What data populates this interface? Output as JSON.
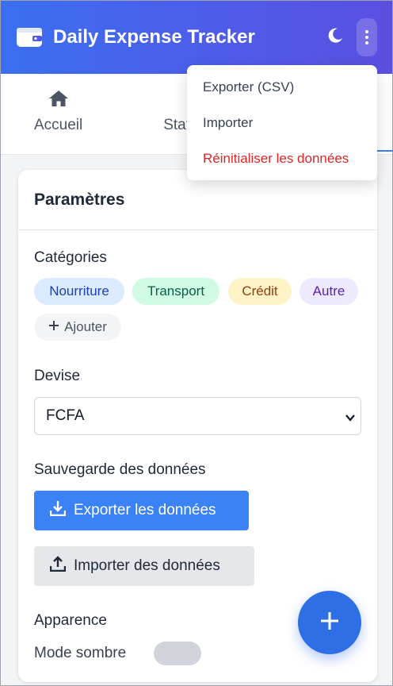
{
  "header": {
    "title": "Daily Expense Tracker"
  },
  "tabs": [
    {
      "label": "Accueil",
      "icon": "home-icon"
    },
    {
      "label": "Statis",
      "icon": "chart-pie-icon"
    }
  ],
  "menu": {
    "items": [
      {
        "label": "Exporter (CSV)"
      },
      {
        "label": "Importer"
      },
      {
        "label": "Réinitialiser les données",
        "color": "#dc2626"
      }
    ]
  },
  "settings": {
    "title": "Paramètres",
    "categories_label": "Catégories",
    "categories": [
      {
        "label": "Nourriture",
        "bg": "#dbeafe",
        "fg": "#1e40af"
      },
      {
        "label": "Transport",
        "bg": "#d1fae5",
        "fg": "#065f46"
      },
      {
        "label": "Crédit",
        "bg": "#fef3c7",
        "fg": "#92400e"
      },
      {
        "label": "Autre",
        "bg": "#ede9fe",
        "fg": "#5b21b6"
      }
    ],
    "add_category_label": "Ajouter",
    "currency_label": "Devise",
    "currency_value": "FCFA",
    "backup_label": "Sauvegarde des données",
    "export_button": "Exporter les données",
    "import_button": "Importer des données",
    "appearance_label": "Apparence",
    "dark_mode_label": "Mode sombre",
    "dark_mode_on": false
  },
  "colors": {
    "accent": "#3b82f6",
    "header_start": "#3b6ff0",
    "header_end": "#5b4fe0",
    "danger": "#dc2626"
  }
}
